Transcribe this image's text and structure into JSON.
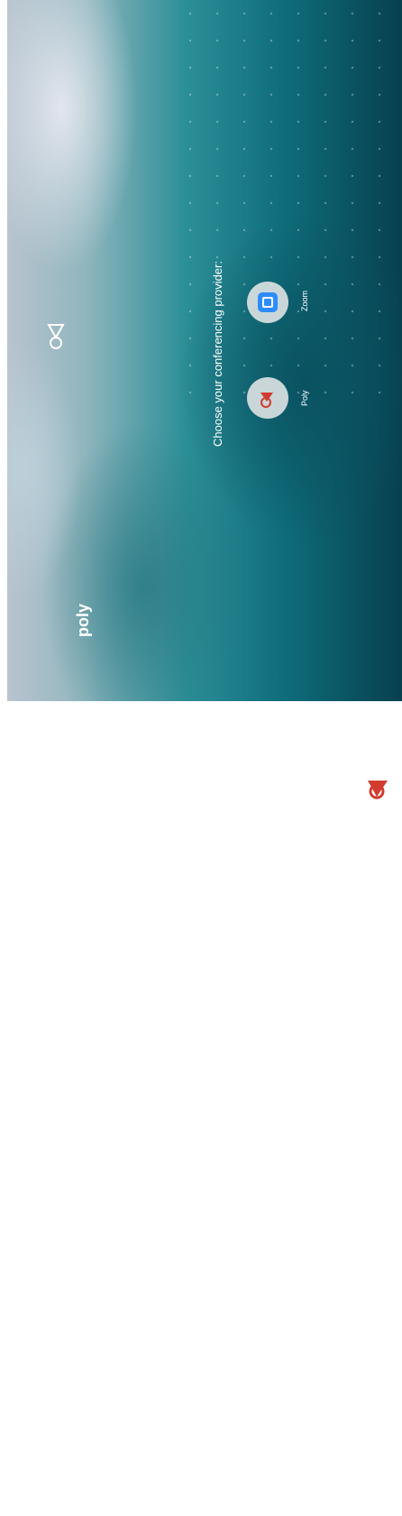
{
  "header": {
    "brand_text": "poly"
  },
  "main": {
    "title": "Choose your conferencing provider:",
    "providers": [
      {
        "label": "Poly",
        "icon": "poly-icon"
      },
      {
        "label": "Zoom",
        "icon": "zoom-icon"
      }
    ]
  },
  "footer": {
    "brand_text": "poly"
  },
  "colors": {
    "accent": "#d13c2f",
    "zoom_blue": "#2d8cff"
  }
}
